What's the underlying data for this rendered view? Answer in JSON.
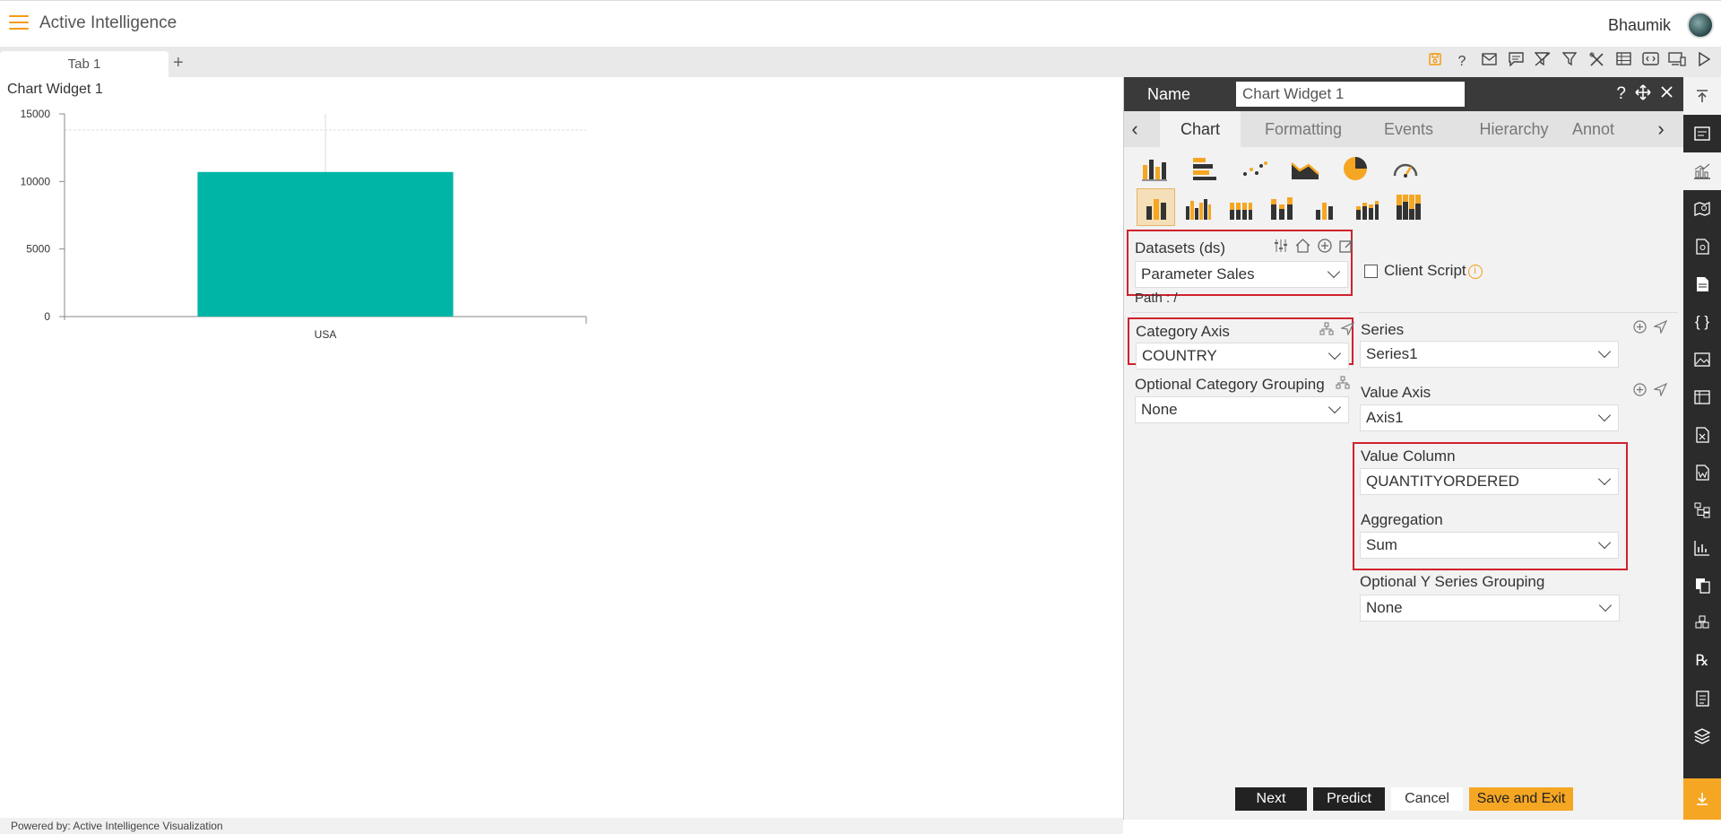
{
  "app": {
    "title": "Active Intelligence",
    "user": "Bhaumik"
  },
  "tabs": [
    {
      "label": "Tab 1"
    }
  ],
  "tab_add": "+",
  "toolbar_icons": [
    "save-icon",
    "help-icon",
    "mail-icon",
    "comment-icon",
    "clear-filter-icon",
    "filter-icon",
    "tools-icon",
    "table-icon",
    "embed-icon",
    "devices-icon",
    "play-icon"
  ],
  "widget": {
    "title": "Chart Widget 1"
  },
  "chart_data": {
    "type": "bar",
    "categories": [
      "USA"
    ],
    "values": [
      10700
    ],
    "ylim": [
      0,
      15000
    ],
    "yticks": [
      0,
      5000,
      10000,
      15000
    ],
    "color": "#00b5a5",
    "title": "",
    "xlabel": "",
    "ylabel": ""
  },
  "footer": "Powered by: Active Intelligence Visualization",
  "panel": {
    "name_label": "Name",
    "name_value": "Chart Widget 1",
    "tabs": [
      "Chart",
      "Formatting",
      "Events",
      "Hierarchy",
      "Annot"
    ],
    "active_tab": "Chart",
    "datasets_label": "Datasets (ds)",
    "dataset_value": "Parameter Sales",
    "path_label": "Path : /",
    "client_script_label": "Client Script",
    "category_axis_label": "Category Axis",
    "category_axis_value": "COUNTRY",
    "optional_category_label": "Optional Category Grouping",
    "optional_category_value": "None",
    "series_label": "Series",
    "series_value": "Series1",
    "value_axis_label": "Value Axis",
    "value_axis_value": "Axis1",
    "value_column_label": "Value Column",
    "value_column_value": "QUANTITYORDERED",
    "aggregation_label": "Aggregation",
    "aggregation_value": "Sum",
    "optional_y_label": "Optional Y Series Grouping",
    "optional_y_value": "None",
    "buttons": {
      "next": "Next",
      "predict": "Predict",
      "cancel": "Cancel",
      "save_exit": "Save and Exit"
    }
  },
  "colors": {
    "accent": "#f39c12",
    "bar": "#00b5a5",
    "highlight_border": "#d0222c",
    "panel_header": "#3a3a3a"
  }
}
